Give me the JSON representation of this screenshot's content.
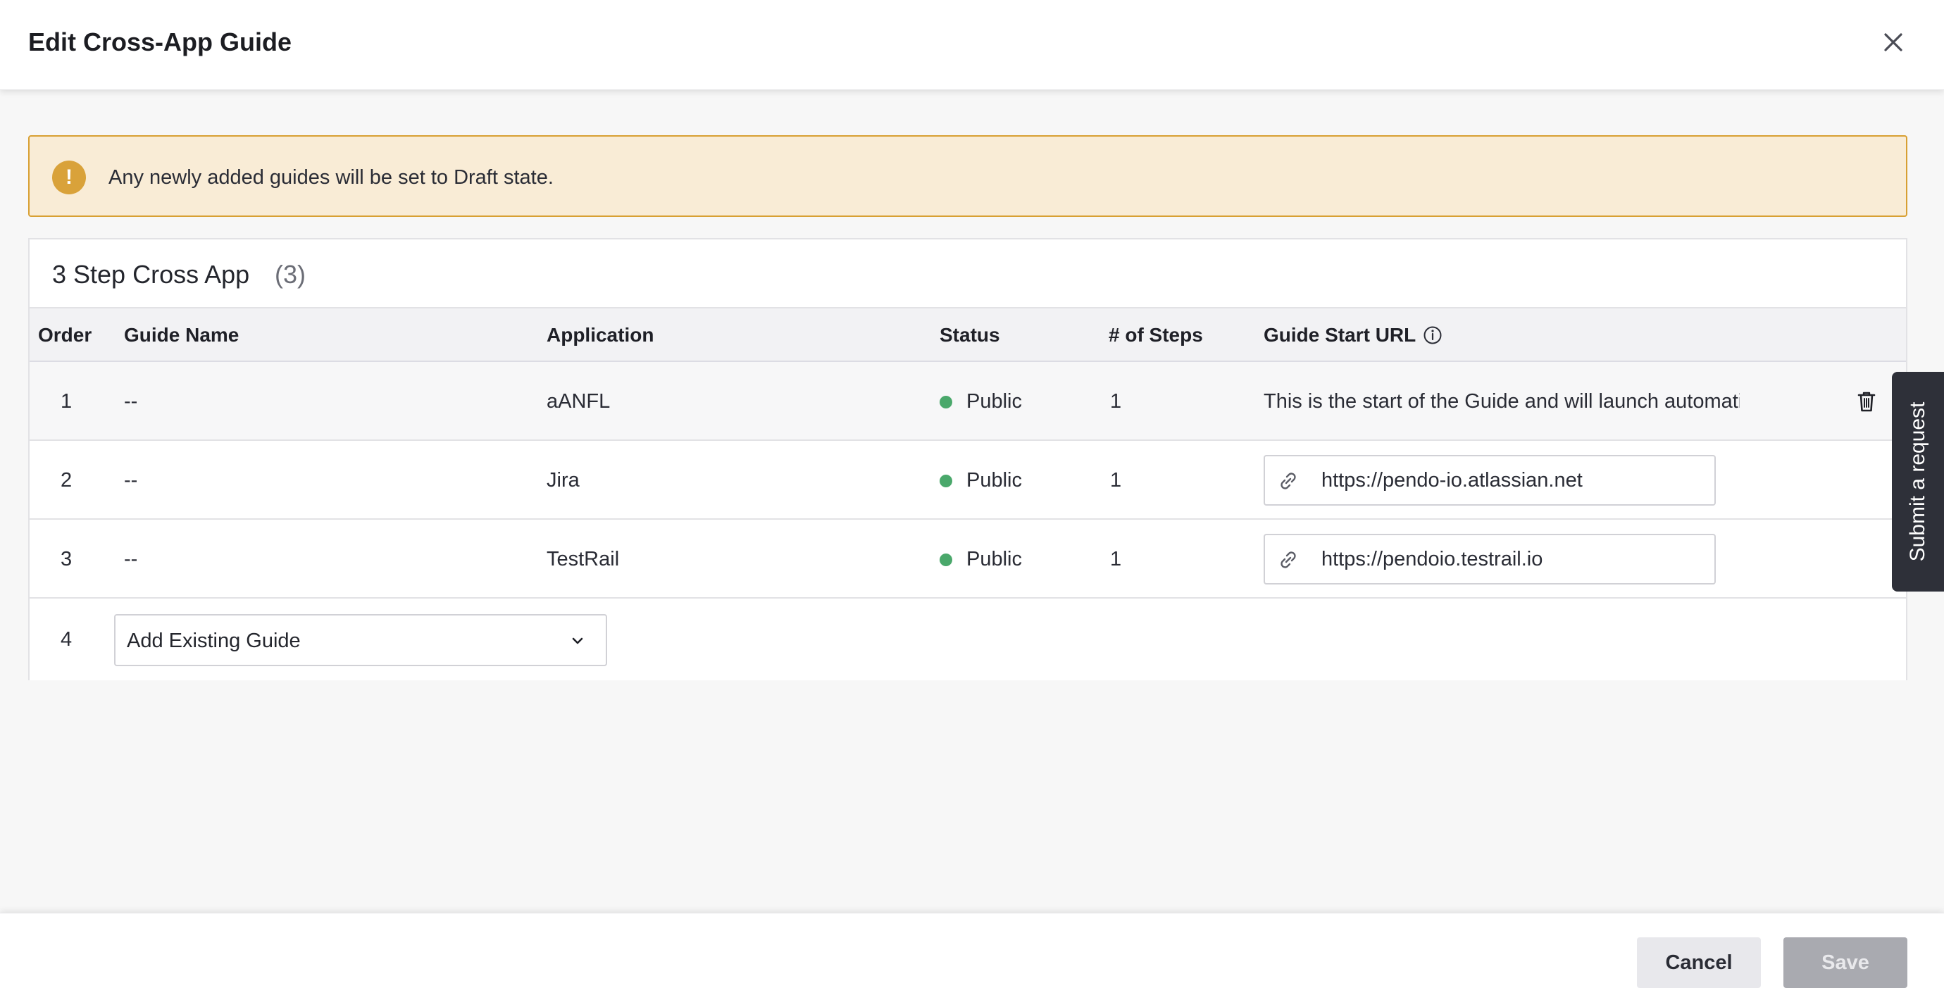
{
  "header": {
    "title": "Edit Cross-App Guide"
  },
  "banner": {
    "message": "Any newly added guides will be set to Draft state."
  },
  "group": {
    "name": "3 Step Cross App",
    "count": "(3)"
  },
  "table": {
    "columns": [
      "Order",
      "Guide Name",
      "Application",
      "Status",
      "# of Steps",
      "Guide Start URL"
    ],
    "rows": [
      {
        "order": "1",
        "guide_name": "--",
        "application": "aANFL",
        "status": "Public",
        "steps": "1",
        "start_url": "This is the start of the Guide and will launch automatically"
      },
      {
        "order": "2",
        "guide_name": "--",
        "application": "Jira",
        "status": "Public",
        "steps": "1",
        "start_url": "https://pendo-io.atlassian.net"
      },
      {
        "order": "3",
        "guide_name": "--",
        "application": "TestRail",
        "status": "Public",
        "steps": "1",
        "start_url": "https://pendoio.testrail.io"
      }
    ],
    "add_row": {
      "order": "4",
      "select_value": "Add Existing Guide"
    }
  },
  "side_tab": {
    "label": "Submit a request"
  },
  "footer": {
    "cancel_label": "Cancel",
    "save_label": "Save"
  },
  "colors": {
    "status_public": "#4aa86b",
    "warning": "#d9a23a",
    "banner_bg": "#f9ecd6"
  },
  "icons": {
    "close": "close-icon",
    "warning": "warning-icon",
    "info": "info-icon",
    "trash": "trash-icon",
    "link": "link-icon",
    "chevron": "chevron-down-icon"
  }
}
